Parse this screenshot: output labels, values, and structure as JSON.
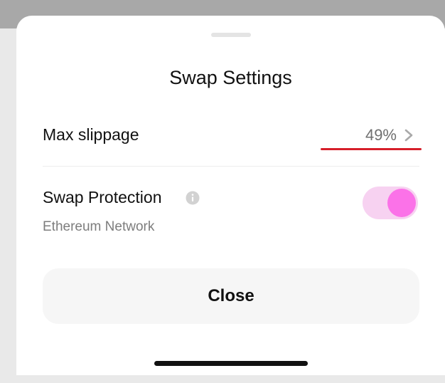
{
  "sheet": {
    "title": "Swap Settings"
  },
  "slippage": {
    "label": "Max slippage",
    "value": "49%",
    "chevron_icon": "chevron-right-icon",
    "underline_color": "#d61f2a"
  },
  "protection": {
    "label": "Swap Protection",
    "info_icon": "info-icon",
    "network": "Ethereum Network",
    "enabled": true,
    "accent_color": "#fb72e8"
  },
  "actions": {
    "close_label": "Close"
  }
}
